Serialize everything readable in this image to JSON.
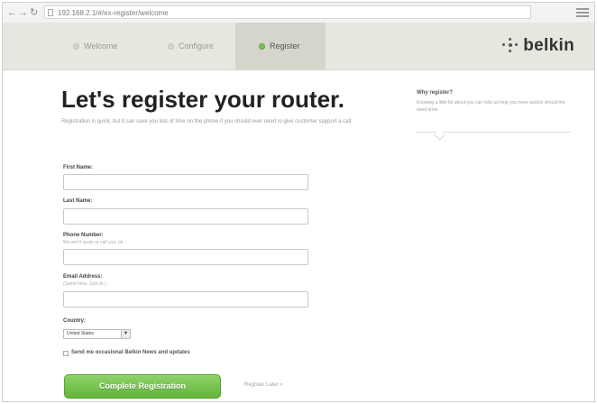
{
  "browser": {
    "back_icon": "arrow-left-icon",
    "forward_icon": "arrow-right-icon",
    "reload_icon": "reload-icon",
    "url": "192.168.2.1/#/ex-register/welcome",
    "menu_icon": "wrench-icon"
  },
  "wizard": {
    "steps": [
      {
        "label": "Welcome",
        "active": false
      },
      {
        "label": "Configure",
        "active": false
      },
      {
        "label": "Register",
        "active": true
      }
    ],
    "brand": "belkin",
    "brand_icon": "belkin-logo-icon"
  },
  "main": {
    "title": "Let's register your router.",
    "intro": "Registration is quick, but it can save you lots of time on the phone if you should ever need to give customer support a call."
  },
  "sidebar": {
    "title": "Why register?",
    "text": "Knowing a little bit about you can help us help you more quickly should the need arise."
  },
  "form": {
    "first_name": {
      "label": "First Name:",
      "value": ""
    },
    "last_name": {
      "label": "Last Name:",
      "value": ""
    },
    "phone": {
      "label": "Phone Number:",
      "hint": "We won't spam or call you, ok.",
      "value": ""
    },
    "email": {
      "label": "Email Address:",
      "hint": "(Same here. Just ok.)",
      "value": ""
    },
    "country": {
      "label": "Country:",
      "selected": "United States"
    },
    "newsletter": {
      "label": "Send me occasional Belkin News and updates",
      "checked": false
    },
    "submit_label": "Complete Registration",
    "later_label": "Register Later »"
  },
  "colors": {
    "accent_green": "#6cbf45",
    "header_bg": "#e7e7e0",
    "active_step_bg": "#d6d5cc"
  }
}
